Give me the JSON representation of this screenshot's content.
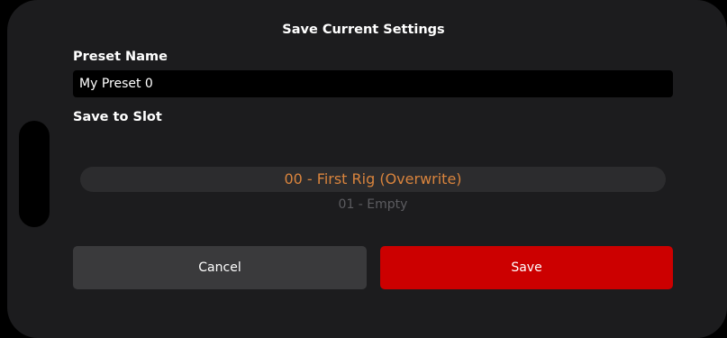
{
  "dialog": {
    "title": "Save Current Settings"
  },
  "preset_name": {
    "label": "Preset Name",
    "value": "My Preset 0"
  },
  "slot": {
    "label": "Save to Slot",
    "options": [
      "00 - First Rig (Overwrite)",
      "01 - Empty"
    ],
    "selected": "00 - First Rig (Overwrite)"
  },
  "actions": {
    "cancel_label": "Cancel",
    "save_label": "Save"
  },
  "colors": {
    "accent": "#cc0000",
    "selected_slot": "#d9843d",
    "sheet_background": "#1c1c1e"
  }
}
